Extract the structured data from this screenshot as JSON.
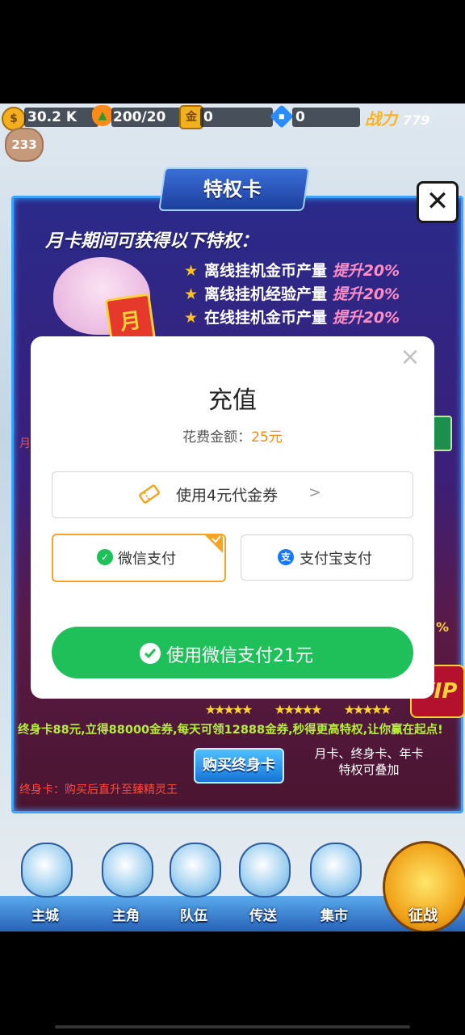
{
  "topbar": {
    "coins": "30.2 K",
    "carrot": "200/20",
    "gold": "0",
    "diamond": "0",
    "power_label": "战力",
    "power_value": "779",
    "level": "233"
  },
  "panel": {
    "title": "特权卡",
    "perk_header": "月卡期间可获得以下特权：",
    "perks": [
      {
        "text": "离线挂机金币产量",
        "boost": "提升20%"
      },
      {
        "text": "离线挂机经验产量",
        "boost": "提升20%"
      },
      {
        "text": "在线挂机金币产量",
        "boost": "提升20%"
      }
    ],
    "card_glyph": "月",
    "left_red_text": "月",
    "right_pct": "%",
    "vip_badge": "VIP",
    "stars": "★★★★★",
    "promo": "终身卡88元,立得88000金券,每天可领12888金券,秒得更高特权,让你赢在起点!",
    "buy_button": "购买终身卡",
    "stack_note_line1": "月卡、终身卡、年卡",
    "stack_note_line2": "特权可叠加",
    "life_note": "终身卡：购买后直升至臻精灵王"
  },
  "nav": {
    "items": [
      "主城",
      "主角",
      "队伍",
      "传送",
      "集市"
    ],
    "campaign": "征战"
  },
  "dialog": {
    "title": "充值",
    "amount_label": "花费金额：",
    "amount_value": "25元",
    "coupon": "使用4元代金券",
    "coupon_arrow": ">",
    "wechat": "微信支付",
    "alipay": "支付宝支付",
    "pay_button": "使用微信支付21元",
    "close": "×"
  },
  "colors": {
    "wechat_green": "#1fbf5a",
    "accent_orange": "#f5a425",
    "amount_orange": "#f08a1a",
    "alipay_blue": "#1677ff"
  }
}
